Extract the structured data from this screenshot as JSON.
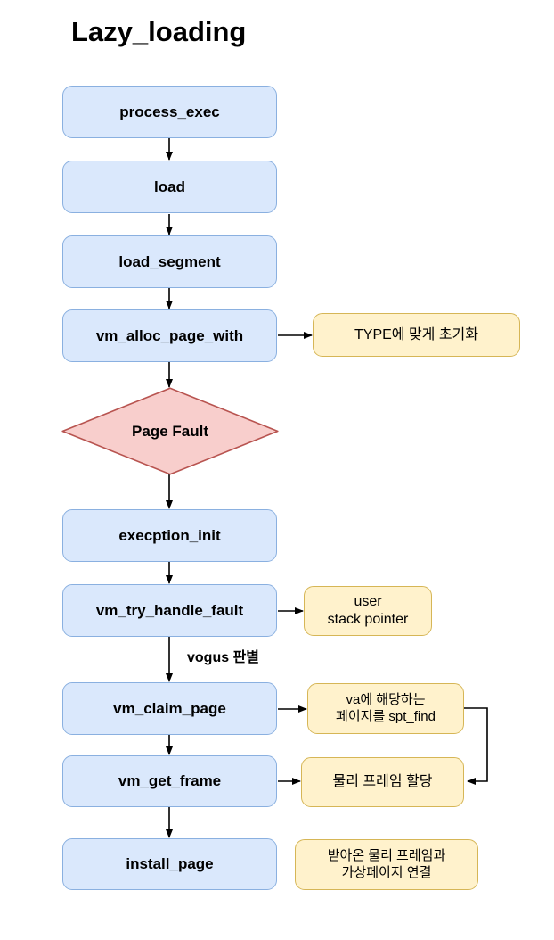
{
  "diagram": {
    "title": "Lazy_loading",
    "type": "flowchart",
    "colors": {
      "process_fill": "#dae8fc",
      "process_stroke": "#8ab0e0",
      "note_fill": "#fff2cc",
      "note_stroke": "#d6b656",
      "decision_fill": "#f8cecc",
      "decision_stroke": "#b85450",
      "edge": "#000000",
      "background": "#ffffff"
    },
    "nodes": [
      {
        "id": "process_exec",
        "label": "process_exec",
        "shape": "process"
      },
      {
        "id": "load",
        "label": "load",
        "shape": "process"
      },
      {
        "id": "load_segment",
        "label": "load_segment",
        "shape": "process"
      },
      {
        "id": "vm_alloc_page_with",
        "label": "vm_alloc_page_with",
        "shape": "process"
      },
      {
        "id": "page_fault",
        "label": "Page Fault",
        "shape": "decision"
      },
      {
        "id": "execption_init",
        "label": "execption_init",
        "shape": "process"
      },
      {
        "id": "vm_try_handle_fault",
        "label": "vm_try_handle_fault",
        "shape": "process"
      },
      {
        "id": "vm_claim_page",
        "label": "vm_claim_page",
        "shape": "process"
      },
      {
        "id": "vm_get_frame",
        "label": "vm_get_frame",
        "shape": "process"
      },
      {
        "id": "install_page",
        "label": "install_page",
        "shape": "process"
      }
    ],
    "notes": [
      {
        "id": "note_type_init",
        "line1": "TYPE에 맞게 초기화",
        "line2": ""
      },
      {
        "id": "note_user_stack",
        "line1": "user",
        "line2": "stack pointer"
      },
      {
        "id": "note_spt_find",
        "line1": "va에 해당하는",
        "line2": "페이지를 spt_find"
      },
      {
        "id": "note_frame_alloc",
        "line1": "물리 프레임 할당",
        "line2": ""
      },
      {
        "id": "note_install",
        "line1": "받아온 물리 프레임과",
        "line2": "가상페이지 연결"
      }
    ],
    "edge_labels": [
      {
        "id": "vogus_label",
        "text": "vogus 판별"
      }
    ]
  }
}
